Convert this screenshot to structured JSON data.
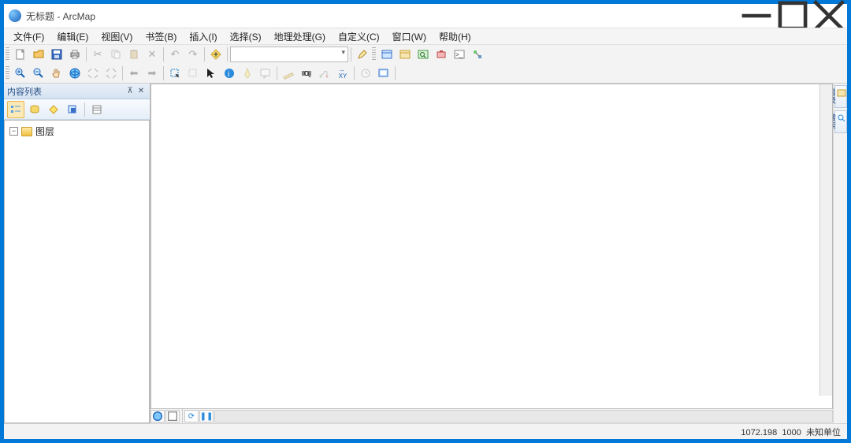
{
  "title": "无标题 - ArcMap",
  "menu": [
    "文件(F)",
    "编辑(E)",
    "视图(V)",
    "书签(B)",
    "插入(I)",
    "选择(S)",
    "地理处理(G)",
    "自定义(C)",
    "窗口(W)",
    "帮助(H)"
  ],
  "scale_box": "",
  "toc": {
    "title": "内容列表",
    "root": "图层"
  },
  "right_dock": [
    "目录",
    "搜索"
  ],
  "status": {
    "x": "1072.198",
    "y": "1000",
    "unit": "未知单位"
  }
}
